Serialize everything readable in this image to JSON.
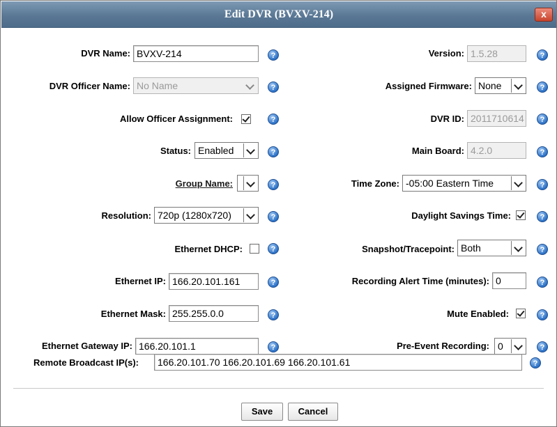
{
  "dialog": {
    "title": "Edit DVR (BVXV-214)",
    "close_label": "x"
  },
  "left": {
    "dvr_name_label": "DVR Name:",
    "dvr_name_value": "BVXV-214",
    "officer_name_label": "DVR Officer Name:",
    "officer_name_value": "No Name",
    "allow_assignment_label": "Allow Officer Assignment:",
    "allow_assignment_checked": true,
    "status_label": "Status:",
    "status_value": "Enabled",
    "group_name_label": "Group Name:",
    "group_name_value": "",
    "resolution_label": "Resolution:",
    "resolution_value": "720p (1280x720)",
    "ethernet_dhcp_label": "Ethernet DHCP:",
    "ethernet_dhcp_checked": false,
    "ethernet_ip_label": "Ethernet IP:",
    "ethernet_ip_value": "166.20.101.161",
    "ethernet_mask_label": "Ethernet Mask:",
    "ethernet_mask_value": "255.255.0.0",
    "ethernet_gateway_label": "Ethernet Gateway IP:",
    "ethernet_gateway_value": "166.20.101.1"
  },
  "right": {
    "version_label": "Version:",
    "version_value": "1.5.28",
    "firmware_label": "Assigned Firmware:",
    "firmware_value": "None",
    "dvr_id_label": "DVR ID:",
    "dvr_id_value": "2011710614",
    "main_board_label": "Main Board:",
    "main_board_value": "4.2.0",
    "time_zone_label": "Time Zone:",
    "time_zone_value": "-05:00 Eastern Time",
    "daylight_label": "Daylight Savings Time:",
    "daylight_checked": true,
    "snapshot_label": "Snapshot/Tracepoint:",
    "snapshot_value": "Both",
    "alert_time_label": "Recording Alert Time (minutes):",
    "alert_time_value": "0",
    "mute_label": "Mute Enabled:",
    "mute_checked": true,
    "pre_event_label": "Pre-Event Recording:",
    "pre_event_value": "0"
  },
  "remote": {
    "label": "Remote Broadcast IP(s):",
    "value": "166.20.101.70 166.20.101.69 166.20.101.61"
  },
  "footer": {
    "save_label": "Save",
    "cancel_label": "Cancel"
  },
  "icons": {
    "help": "help-icon",
    "close": "close-icon",
    "dropdown": "chevron-down-icon",
    "checkbox": "checkmark-icon"
  }
}
